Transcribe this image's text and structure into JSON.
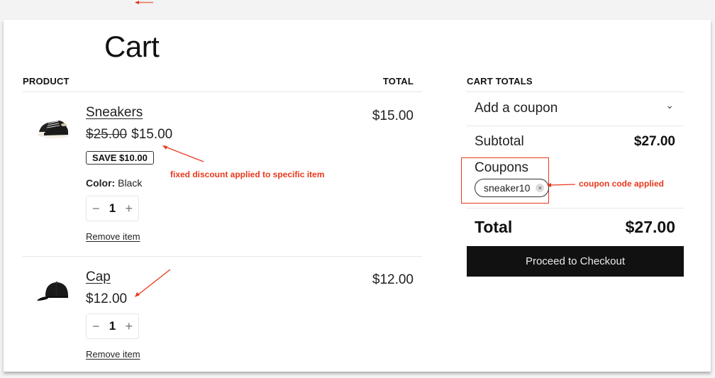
{
  "page": {
    "title": "Cart"
  },
  "table": {
    "headers": {
      "product": "PRODUCT",
      "total": "TOTAL"
    },
    "items": [
      {
        "name": "Sneakers",
        "image_icon": "sneakers-image",
        "original_price": "$25.00",
        "price": "$15.00",
        "badge": "SAVE $10.00",
        "attribute_label": "Color:",
        "attribute_value": "Black",
        "quantity": "1",
        "decrement": "−",
        "increment": "+",
        "remove_label": "Remove item",
        "line_total": "$15.00"
      },
      {
        "name": "Cap",
        "image_icon": "cap-image",
        "price": "$12.00",
        "quantity": "1",
        "decrement": "−",
        "increment": "+",
        "remove_label": "Remove item",
        "line_total": "$12.00"
      }
    ]
  },
  "totals": {
    "heading": "CART TOTALS",
    "add_coupon_label": "Add a coupon",
    "add_coupon_chevron": "⌄",
    "subtotal_label": "Subtotal",
    "subtotal_value": "$27.00",
    "coupons_label": "Coupons",
    "coupon_code": "sneaker10",
    "coupon_remove": "×",
    "total_label": "Total",
    "total_value": "$27.00",
    "checkout_label": "Proceed to Checkout"
  },
  "annotations": {
    "item_discount": "fixed discount applied to specific item",
    "coupon_applied": "coupon code applied",
    "color": "#e8381c"
  }
}
